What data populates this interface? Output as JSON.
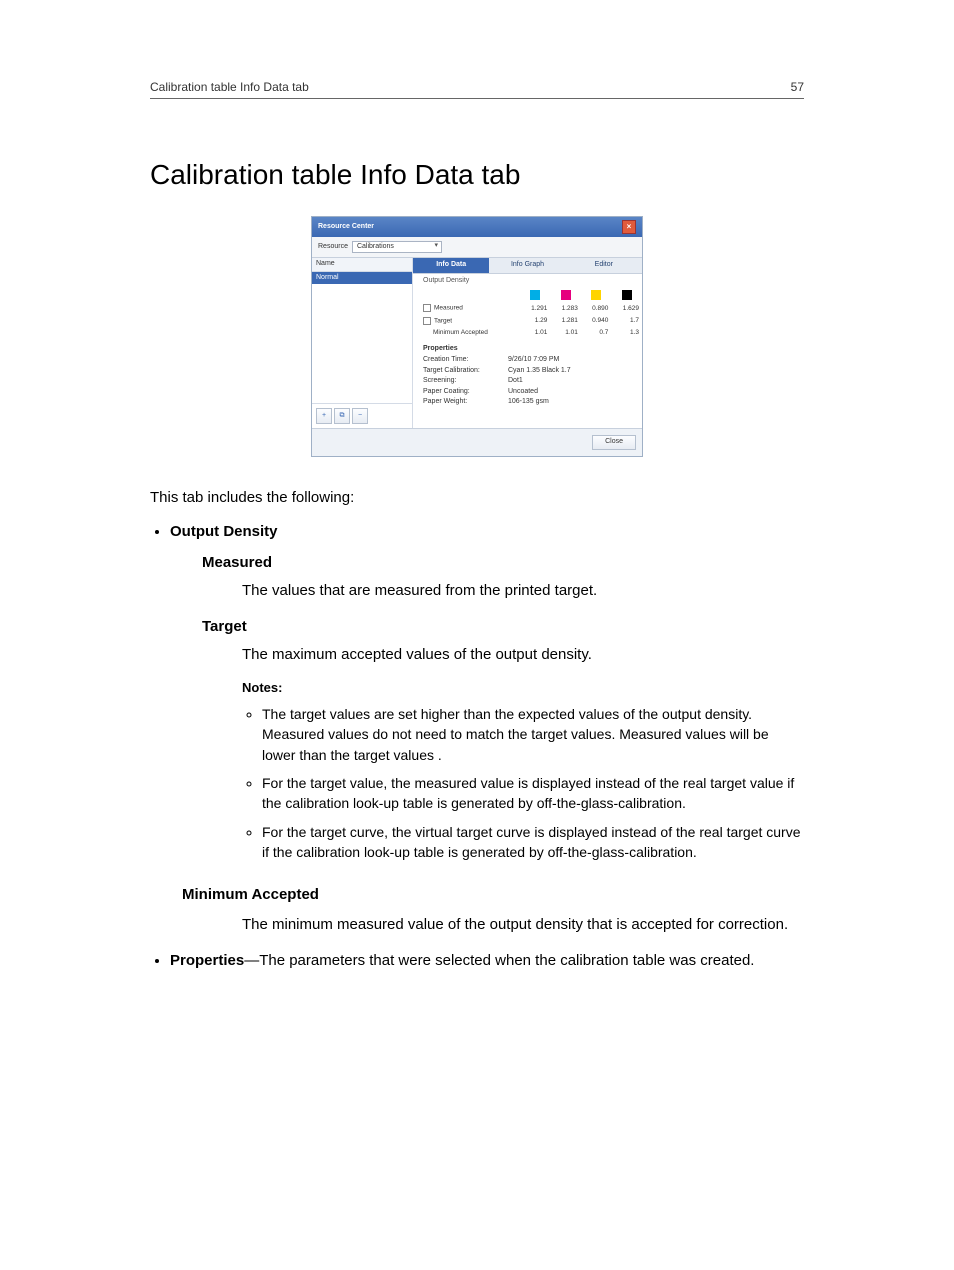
{
  "header": {
    "left": "Calibration table Info Data tab",
    "right": "57"
  },
  "title": "Calibration table Info Data tab",
  "shot": {
    "window_title": "Resource Center",
    "toolbar": {
      "label": "Resource",
      "select_value": "Calibrations"
    },
    "side": {
      "column_label": "Name",
      "selected_item": "Normal"
    },
    "tabs": {
      "info_data": "Info Data",
      "info_graph": "Info Graph",
      "editor": "Editor"
    },
    "density": {
      "heading": "Output Density",
      "cols": {
        "c": "C",
        "m": "M",
        "y": "Y",
        "k": "K"
      },
      "rows": {
        "measured": {
          "label": "Measured",
          "c": "1.291",
          "m": "1.283",
          "y": "0.890",
          "k": "1.629"
        },
        "target": {
          "label": "Target",
          "c": "1.29",
          "m": "1.281",
          "y": "0.940",
          "k": "1.7"
        },
        "minacc": {
          "label": "Minimum Accepted",
          "c": "1.01",
          "m": "1.01",
          "y": "0.7",
          "k": "1.3"
        }
      }
    },
    "properties": {
      "heading": "Properties",
      "creation_time": {
        "label": "Creation Time:",
        "value": "9/26/10 7:09 PM"
      },
      "target_cal": {
        "label": "Target Calibration:",
        "value": "Cyan 1.35 Black 1.7"
      },
      "screening": {
        "label": "Screening:",
        "value": "Dot1"
      },
      "paper_coating": {
        "label": "Paper Coating:",
        "value": "Uncoated"
      },
      "paper_weight": {
        "label": "Paper Weight:",
        "value": "106-135 gsm"
      }
    },
    "close_button": "Close"
  },
  "doc": {
    "intro": "This tab includes the following:",
    "output_density_label": "Output Density",
    "measured_term": "Measured",
    "measured_desc": "The values that are measured from the printed target.",
    "target_term": "Target",
    "target_desc": "The maximum accepted values of the output density.",
    "notes_label": "Notes:",
    "note1": "The target values are set higher than the expected values of the output density. Measured values do not need to match the target values. Measured values will be lower than the target values .",
    "note2": "For the target value, the measured value is displayed instead of the real target value if the calibration look-up table is generated by off-the-glass-calibration.",
    "note3": "For the target curve, the virtual target curve is displayed instead of the real target curve if the calibration look-up table is generated by off-the-glass-calibration.",
    "minacc_term": "Minimum Accepted",
    "minacc_desc": "The minimum measured value of the output density that is accepted for correction.",
    "properties_label": "Properties",
    "properties_desc": "—The parameters that were selected when the calibration table was created."
  },
  "chart_data": {
    "type": "table",
    "title": "Output Density",
    "categories": [
      "C",
      "M",
      "Y",
      "K"
    ],
    "series": [
      {
        "name": "Measured",
        "values": [
          1.291,
          1.283,
          0.89,
          1.629
        ]
      },
      {
        "name": "Target",
        "values": [
          1.29,
          1.281,
          0.94,
          1.7
        ]
      },
      {
        "name": "Minimum Accepted",
        "values": [
          1.01,
          1.01,
          0.7,
          1.3
        ]
      }
    ]
  }
}
